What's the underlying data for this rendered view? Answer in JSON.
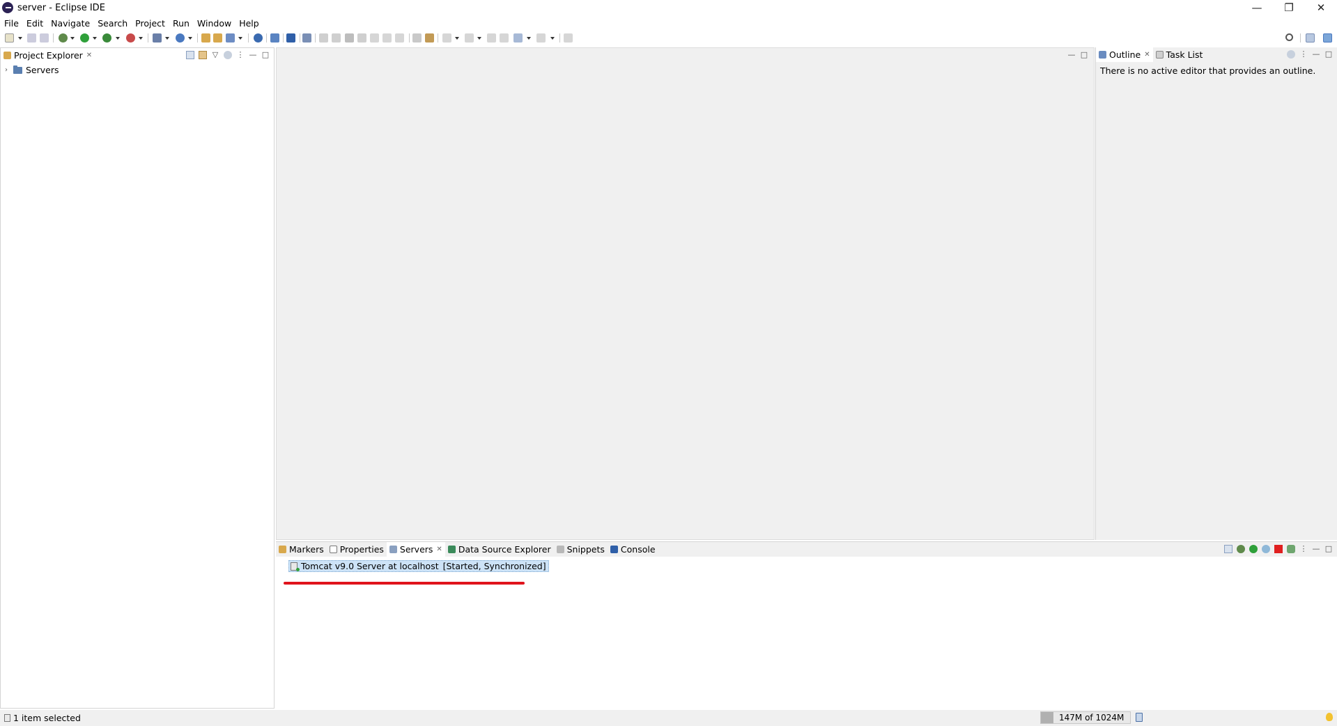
{
  "window": {
    "title": "server - Eclipse IDE",
    "controls": {
      "minimize": "—",
      "restore": "❐",
      "close": "✕"
    }
  },
  "menubar": {
    "items": [
      "File",
      "Edit",
      "Navigate",
      "Search",
      "Project",
      "Run",
      "Window",
      "Help"
    ]
  },
  "project_explorer": {
    "tab_label": "Project Explorer",
    "tree": [
      {
        "label": "Servers",
        "expanded": false
      }
    ]
  },
  "outline": {
    "tabs": [
      "Outline",
      "Task List"
    ],
    "message": "There is no active editor that provides an outline."
  },
  "bottom_panel": {
    "tabs": [
      "Markers",
      "Properties",
      "Servers",
      "Data Source Explorer",
      "Snippets",
      "Console"
    ],
    "active_tab": "Servers",
    "servers": [
      {
        "name": "Tomcat v9.0 Server at localhost",
        "state": "[Started, Synchronized]"
      }
    ]
  },
  "statusbar": {
    "selection": "1 item selected",
    "heap": "147M of 1024M",
    "heap_used_fraction": 0.14
  },
  "colors": {
    "highlight_underline": "#e0141c",
    "selected_row": "#cde3f7",
    "stop_button": "#e02020",
    "run_button": "#2fa03a"
  }
}
